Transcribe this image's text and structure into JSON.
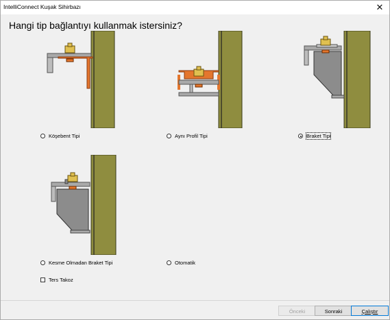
{
  "window": {
    "title": "IntelliConnect Kuşak Sihirbazı",
    "close_glyph": "✕"
  },
  "question": "Hangi tip bağlantıyı kullanmak istersiniz?",
  "options": [
    {
      "label": "Köşebent Tipi",
      "selected": false
    },
    {
      "label": "Aynı Profil Tipi",
      "selected": false
    },
    {
      "label": "Braket Tipi",
      "selected": true
    },
    {
      "label": "Kesme Olmadan Braket Tipi",
      "selected": false
    },
    {
      "label": "Otomatik",
      "selected": false
    }
  ],
  "checkbox": {
    "label": "Ters Takoz",
    "checked": false
  },
  "buttons": {
    "back": "Önceki",
    "next": "Sonraki",
    "run": "Çalıştır"
  },
  "colors": {
    "column": "#8f8d3f",
    "steel": "#8c8c8c",
    "highlight": "#e4762d",
    "bolt": "#e0c050"
  }
}
